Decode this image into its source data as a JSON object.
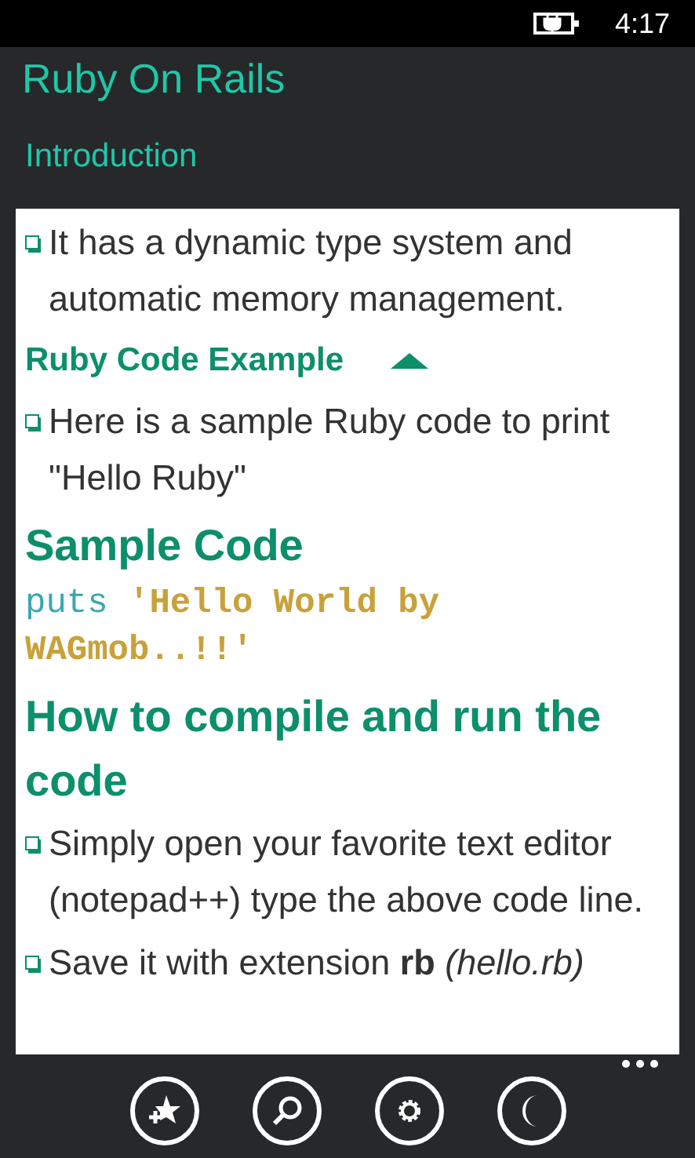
{
  "status_bar": {
    "time": "4:17"
  },
  "app_title": "Ruby On Rails",
  "page_title": "Introduction",
  "content": [
    {
      "kind": "bullet",
      "text": "It has a dynamic type system and automatic memory management."
    },
    {
      "kind": "subheading",
      "text": "Ruby Code Example",
      "expanded": true
    },
    {
      "kind": "bullet",
      "text": "Here is a sample Ruby code to print \"Hello Ruby\""
    },
    {
      "kind": "heading",
      "text": "Sample Code"
    },
    {
      "kind": "code",
      "keyword": "puts",
      "string": "'Hello World by WAGmob..!!'"
    },
    {
      "kind": "heading",
      "text": "How to compile and run the code"
    },
    {
      "kind": "bullet",
      "text": "Simply open your favorite text editor (notepad++) type the above code line."
    },
    {
      "kind": "bullet",
      "text": "Save it with extension **rb** *(hello.rb)*"
    }
  ]
}
